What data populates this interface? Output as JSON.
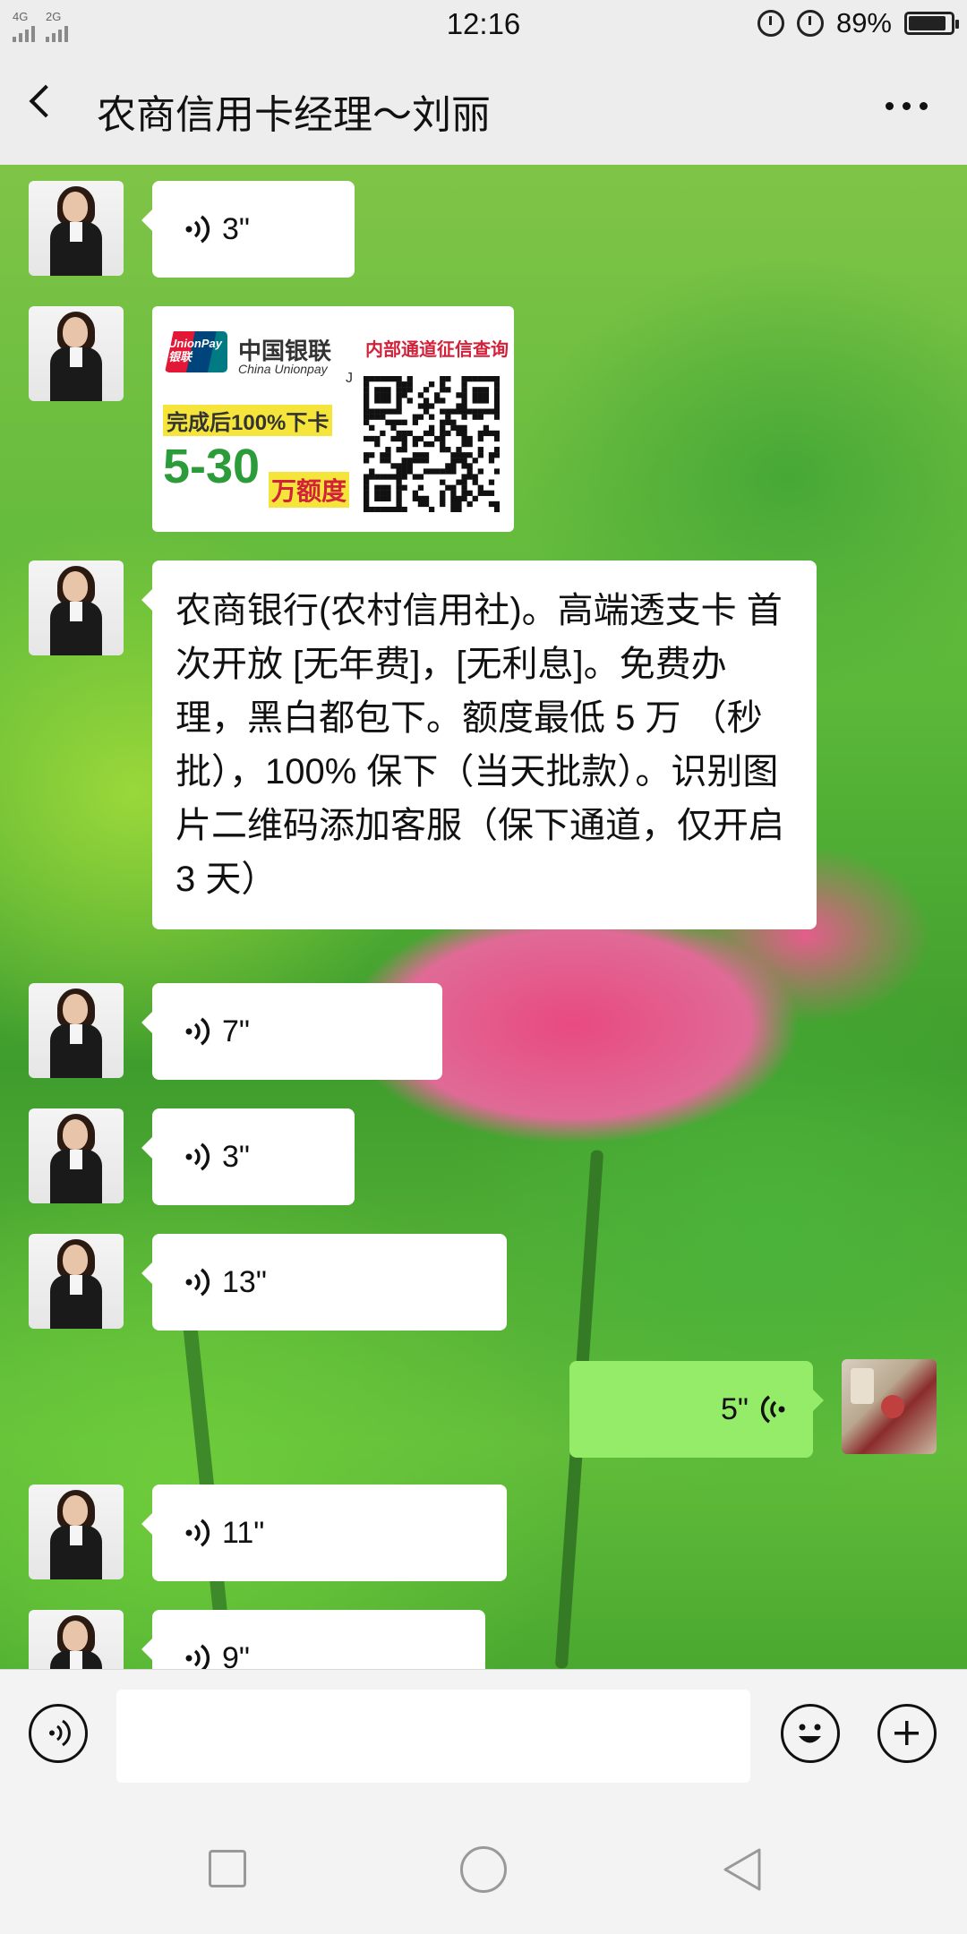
{
  "status_bar": {
    "signal_1_label": "4G",
    "signal_2_label": "2G",
    "time": "12:16",
    "battery_percent": "89%",
    "battery_level": 0.89
  },
  "header": {
    "title": "农商信用卡经理～刘丽"
  },
  "messages": [
    {
      "type": "voice",
      "side": "left",
      "duration": "3\""
    },
    {
      "type": "image",
      "side": "left",
      "image_text": {
        "brand_en": "UnionPay",
        "brand_en_sub": "银联",
        "brand_cn": "中国银联",
        "brand_en_full": "China Unionpay",
        "channel": "内部通道征信查询",
        "mark": "J",
        "promise": "完成后100%下卡",
        "range": "5-30",
        "limit": "万额度"
      }
    },
    {
      "type": "text",
      "side": "left",
      "text": "农商银行(农村信用社)。高端透支卡 首次开放 [无年费]，[无利息]。免费办理，黑白都包下。额度最低 5 万 （秒批），100% 保下（当天批款）。识别图片二维码添加客服（保下通道，仅开启 3 天）"
    },
    {
      "type": "voice",
      "side": "left",
      "duration": "7\""
    },
    {
      "type": "voice",
      "side": "left",
      "duration": "3\""
    },
    {
      "type": "voice",
      "side": "left",
      "duration": "13\""
    },
    {
      "type": "voice",
      "side": "right",
      "duration": "5\""
    },
    {
      "type": "voice",
      "side": "left",
      "duration": "11\""
    },
    {
      "type": "voice",
      "side": "left",
      "duration": "9\""
    }
  ],
  "icons": {
    "back": "chevron-left-icon",
    "more": "more-dots-icon",
    "voice_input": "voice-input-icon",
    "emoji": "emoji-icon",
    "add": "plus-icon"
  },
  "colors": {
    "bubble_other": "#ffffff",
    "bubble_self": "#95ec69",
    "chrome": "#ededed"
  }
}
